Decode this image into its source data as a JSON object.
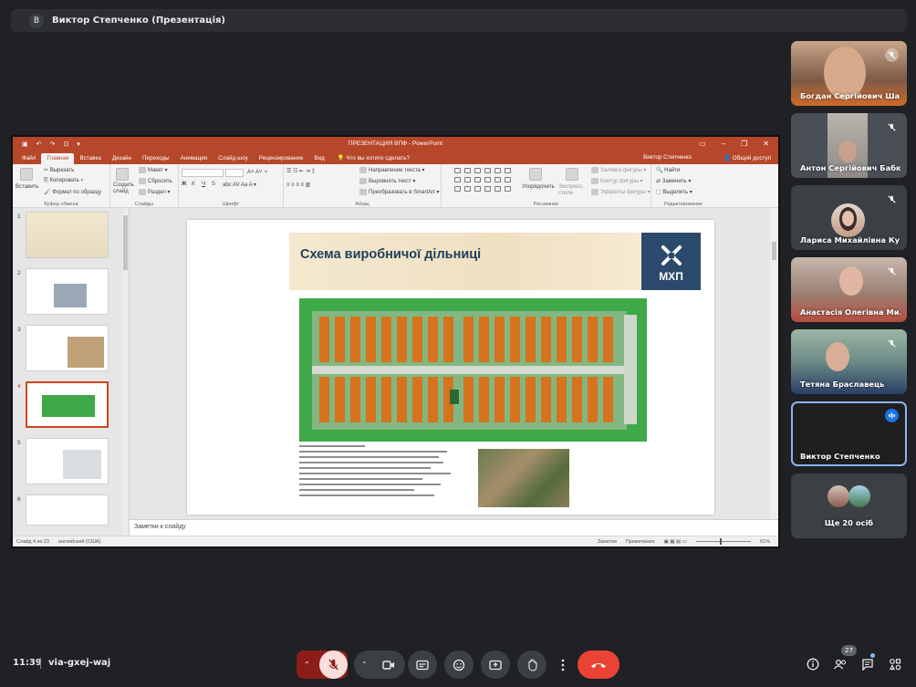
{
  "presenter_bar": {
    "avatar_letter": "В",
    "title": "Виктор Степченко (Презентація)"
  },
  "powerpoint": {
    "title": "ПРЕЗЕНТАЦИЯ ВПФ - PowerPoint",
    "tabs": [
      "Файл",
      "Главная",
      "Вставка",
      "Дизайн",
      "Переходы",
      "Анимация",
      "Слайд-шоу",
      "Рецензирование",
      "Вид"
    ],
    "active_tab": "Главная",
    "tell_me": "Что вы хотите сделать?",
    "user": "Виктор Степченко",
    "share": "Общий доступ",
    "clipboard": {
      "paste": "Вставить",
      "cut": "Вырезать",
      "copy": "Копировать",
      "format_painter": "Формат по образцу",
      "group": "Буфер обмена"
    },
    "slides_group": {
      "new_slide": "Создать слайд",
      "layout": "Макет",
      "reset": "Сбросить",
      "section": "Раздел",
      "group": "Слайды"
    },
    "font_group": {
      "bold": "Ж",
      "italic": "К",
      "underline": "Ч",
      "strike": "S",
      "group": "Шрифт"
    },
    "paragraph_group": {
      "text_direction": "Направление текста",
      "align_text": "Выровнять текст",
      "smartart": "Преобразовать в SmartArt",
      "group": "Абзац"
    },
    "drawing_group": {
      "arrange": "Упорядочить",
      "quick_styles": "Экспресс-стили",
      "shape_fill": "Заливка фигуры",
      "shape_outline": "Контур фигуры",
      "shape_effects": "Эффекты фигуры",
      "group": "Рисование"
    },
    "editing_group": {
      "find": "Найти",
      "replace": "Заменить",
      "select": "Выделить",
      "group": "Редактирование"
    },
    "slide_numbers": [
      "1",
      "2",
      "3",
      "4",
      "5",
      "6"
    ],
    "active_slide": "4",
    "slide": {
      "heading": "Схема виробничої дільниці",
      "logo_text": "МХП"
    },
    "notes_placeholder": "Заметки к слайду",
    "status": {
      "slide_of": "Слайд 4 из 23",
      "language": "английский (США)",
      "notes": "Заметки",
      "comments": "Примечания",
      "zoom": "61%"
    }
  },
  "participants": [
    {
      "name": "Богдан Сергійович Ша...",
      "muted": true
    },
    {
      "name": "Антон Сергійович Бабко",
      "muted": true
    },
    {
      "name": "Лариса Михайлівна Ку...",
      "muted": true
    },
    {
      "name": "Анастасія Олегівна Ми...",
      "muted": true
    },
    {
      "name": "Тетяна Браславець",
      "muted": true
    },
    {
      "name": "Виктор Степченко",
      "muted": false,
      "speaking": true
    }
  ],
  "more_participants": "Ще 20 осіб",
  "bottom_bar": {
    "time": "11:39",
    "meeting_code": "via-gxej-waj",
    "people_count": "27"
  },
  "colors": {
    "background": "#202124",
    "powerpoint_accent": "#b7472a",
    "mic_off_red": "#8c1d18",
    "end_call_red": "#ea4335",
    "speaking_blue": "#8ab4f8"
  }
}
